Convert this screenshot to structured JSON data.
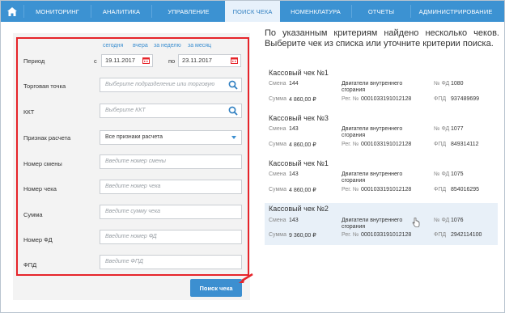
{
  "nav": {
    "home_icon": "home-icon",
    "items": [
      {
        "label": "МОНИТОРИНГ"
      },
      {
        "label": "АНАЛИТИКА"
      },
      {
        "label": "УПРАВЛЕНИЕ"
      },
      {
        "label": "ПОИСК ЧЕКА"
      },
      {
        "label": "НОМЕНКЛАТУРА"
      },
      {
        "label": "ОТЧЕТЫ"
      },
      {
        "label": "АДМИНИСТРИРОВАНИЕ"
      }
    ],
    "active": "ПОИСК ЧЕКА",
    "color": "#3c92d2"
  },
  "form": {
    "quick": {
      "today": "сегодня",
      "yesterday": "вчера",
      "week": "за неделю",
      "month": "за месяц"
    },
    "period": {
      "label": "Период",
      "from_label": "с",
      "from": "19.11.2017",
      "to_label": "по",
      "to": "23.11.2017"
    },
    "outlet": {
      "label": "Торговая точка",
      "placeholder": "Выберите подразделение или торговую"
    },
    "kkt": {
      "label": "ККТ",
      "placeholder": "Выберите ККТ"
    },
    "calc": {
      "label": "Признак расчета",
      "value": "Все признаки расчета"
    },
    "shift": {
      "label": "Номер смены",
      "placeholder": "Введите номер смены"
    },
    "check": {
      "label": "Номер чека",
      "placeholder": "Введите номер чека"
    },
    "sum": {
      "label": "Сумма",
      "placeholder": "Введите сумму чека"
    },
    "fd": {
      "label": "Номер ФД",
      "placeholder": "Введите номер ФД"
    },
    "fpd": {
      "label": "ФПД",
      "placeholder": "Введите ФПД"
    },
    "submit": "Поиск чека"
  },
  "results": {
    "message": "По указанным критериям найдено несколько чеков. Выберите чек из списка или уточните критерии поиска.",
    "labels": {
      "shift": "Смена",
      "sum": "Сумма",
      "reg": "Рег. №",
      "fd": "№ ФД",
      "fpd": "ФПД"
    },
    "items": [
      {
        "title": "Кассовый чек №1",
        "shift": "144",
        "sum": "4 860,00 ₽",
        "desc": "Двигатели внутреннего сгорания",
        "reg": "0001033191012128",
        "fd": "1080",
        "fpd": "937489699"
      },
      {
        "title": "Кассовый чек №3",
        "shift": "143",
        "sum": "4 860,00 ₽",
        "desc": "Двигатели внутреннего сгорания",
        "reg": "0001033191012128",
        "fd": "1077",
        "fpd": "849314112"
      },
      {
        "title": "Кассовый чек №1",
        "shift": "143",
        "sum": "4 860,00 ₽",
        "desc": "Двигатели внутреннего сгорания",
        "reg": "0001033191012128",
        "fd": "1075",
        "fpd": "854016295"
      },
      {
        "title": "Кассовый чек №2",
        "shift": "143",
        "sum": "9 360,00 ₽",
        "desc": "Двигатели внутреннего сгорания",
        "reg": "0001033191012128",
        "fd": "1076",
        "fpd": "2942114100"
      }
    ]
  }
}
